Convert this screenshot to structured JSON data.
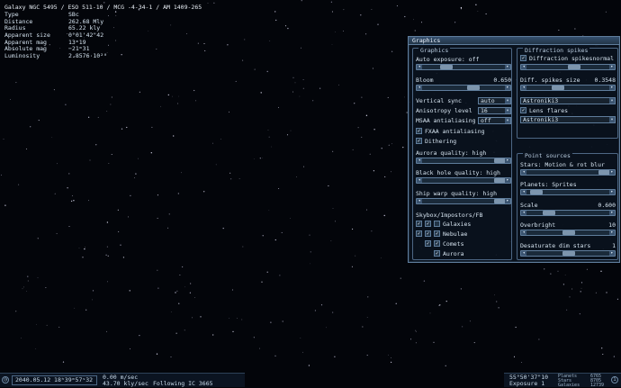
{
  "object_info": {
    "title": "Galaxy  NGC 5495 / ESO 511-10 / MCG -4-34-1 / AM 1409-265",
    "properties": [
      {
        "name": "Type",
        "value": "SBc"
      },
      {
        "name": "Distance",
        "value": "262.68 Mly"
      },
      {
        "name": "Radius",
        "value": "65.22 kly"
      },
      {
        "name": "Apparent size",
        "value": "0°01'42\"42"
      },
      {
        "name": "Apparent mag",
        "value": "13ᵐ19"
      },
      {
        "name": "Absolute mag",
        "value": "−21ᵐ31"
      },
      {
        "name": "Luminosity",
        "value": "2.8576·10²⁰"
      }
    ]
  },
  "graphics_window": {
    "title": "Graphics",
    "graphics_group": {
      "title": "Graphics",
      "auto_exposure_label": "Auto exposure: off",
      "bloom_label": "Bloom",
      "bloom_value": "0.650",
      "vertical_sync_label": "Vertical sync",
      "vertical_sync_value": "auto",
      "anisotropy_label": "Anisotropy level",
      "anisotropy_value": "16",
      "msaa_label": "MSAA antialiasing",
      "msaa_value": "off",
      "fxaa_label": "FXAA antialiasing",
      "fxaa_checked": true,
      "dithering_label": "Dithering",
      "dithering_checked": true,
      "aurora_label": "Aurora quality: high",
      "black_hole_label": "Black hole quality: high",
      "ship_warp_label": "Ship warp quality: high",
      "skybox_label": "Skybox/Impostors/FB",
      "skybox_items": [
        "Galaxies",
        "Nebulae",
        "Comets",
        "Aurora"
      ]
    },
    "diffraction_group": {
      "title": "Diffraction spikes",
      "spikes_label": "Diffraction spikes",
      "spikes_mode": "normal",
      "spikes_size_label": "Diff. spikes size",
      "spikes_size_value": "0.3548",
      "spikes_preset": "Astroniki3",
      "lens_flares_label": "Lens flares",
      "lens_flares_preset": "Astroniki3"
    },
    "point_sources_group": {
      "title": "Point sources",
      "stars_label": "Stars: Motion & rot blur",
      "planets_label": "Planets: Sprites",
      "scale_label": "Scale",
      "scale_value": "0.600",
      "overbright_label": "Overbright",
      "overbright_value": "10",
      "desaturate_label": "Desaturate dim stars",
      "desaturate_value": "1"
    }
  },
  "status_left": {
    "datetime": "2040.05.12  18ʰ39ᵐ57ˢ32",
    "speed": "0.00 m/sec",
    "velocity": "43.70 kly/sec",
    "following": "Following IC 3665"
  },
  "status_right": {
    "angle": "55°50'37\"10",
    "exposure": "Exposure 1",
    "stats": [
      {
        "name": "Planets",
        "value": "6765"
      },
      {
        "name": "Stars",
        "value": "8705"
      },
      {
        "name": "Galaxies",
        "value": "12739"
      }
    ]
  }
}
